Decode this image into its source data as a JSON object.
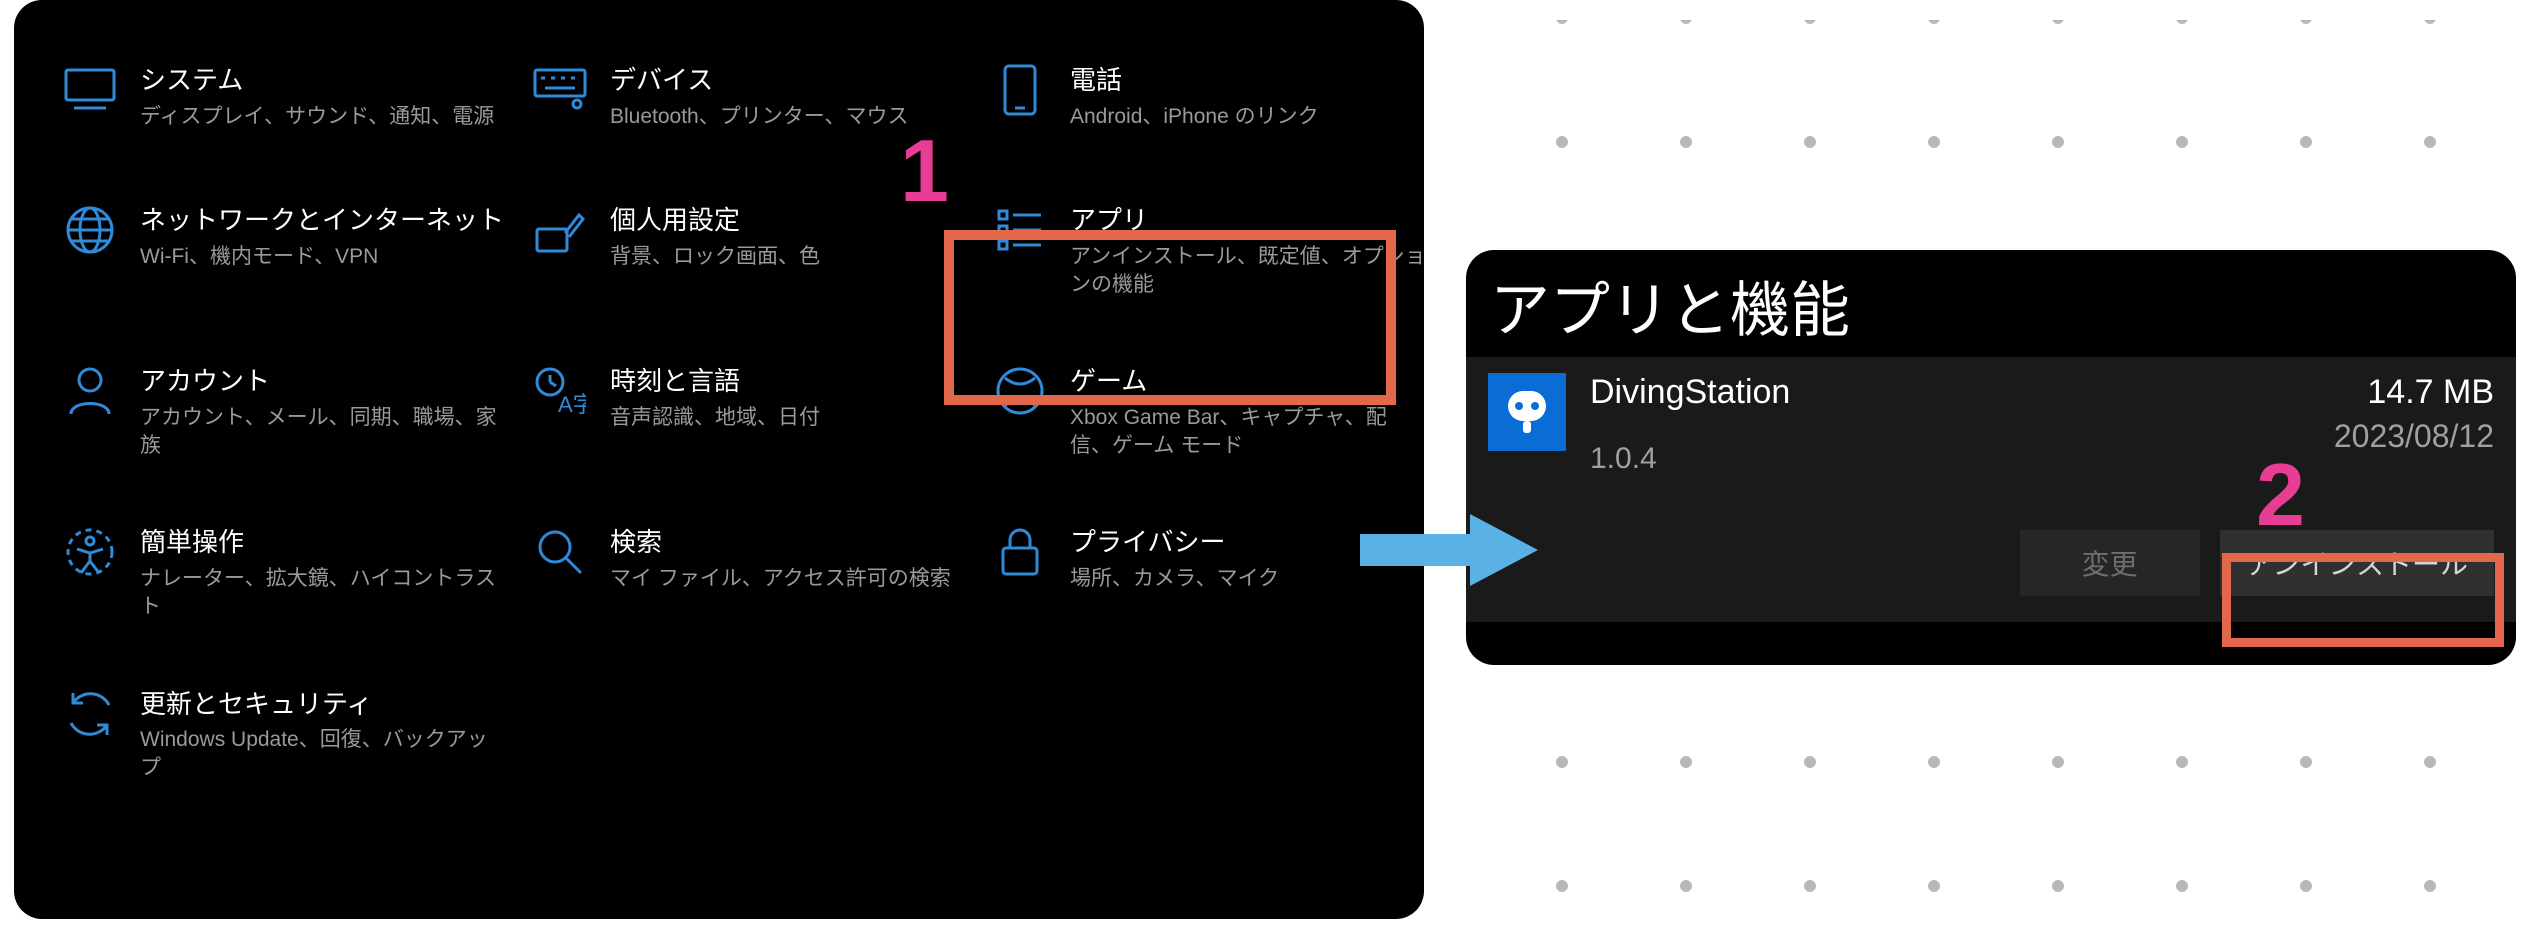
{
  "step_labels": {
    "one": "1",
    "two": "2"
  },
  "settings": {
    "categories": [
      {
        "title": "システム",
        "desc": "ディスプレイ、サウンド、通知、電源"
      },
      {
        "title": "デバイス",
        "desc": "Bluetooth、プリンター、マウス"
      },
      {
        "title": "電話",
        "desc": "Android、iPhone のリンク"
      },
      {
        "title": "ネットワークとインターネット",
        "desc": "Wi-Fi、機内モード、VPN"
      },
      {
        "title": "個人用設定",
        "desc": "背景、ロック画面、色"
      },
      {
        "title": "アプリ",
        "desc": "アンインストール、既定値、オプションの機能"
      },
      {
        "title": "アカウント",
        "desc": "アカウント、メール、同期、職場、家族"
      },
      {
        "title": "時刻と言語",
        "desc": "音声認識、地域、日付"
      },
      {
        "title": "ゲーム",
        "desc": "Xbox Game Bar、キャプチャ、配信、ゲーム モード"
      },
      {
        "title": "簡単操作",
        "desc": "ナレーター、拡大鏡、ハイコントラスト"
      },
      {
        "title": "検索",
        "desc": "マイ ファイル、アクセス許可の検索"
      },
      {
        "title": "プライバシー",
        "desc": "場所、カメラ、マイク"
      },
      {
        "title": "更新とセキュリティ",
        "desc": "Windows Update、回復、バックアップ"
      }
    ]
  },
  "apps_panel": {
    "header": "アプリと機能",
    "app": {
      "name": "DivingStation",
      "version": "1.0.4",
      "size": "14.7 MB",
      "date": "2023/08/12"
    },
    "buttons": {
      "modify": "変更",
      "uninstall": "アンインストール"
    }
  }
}
